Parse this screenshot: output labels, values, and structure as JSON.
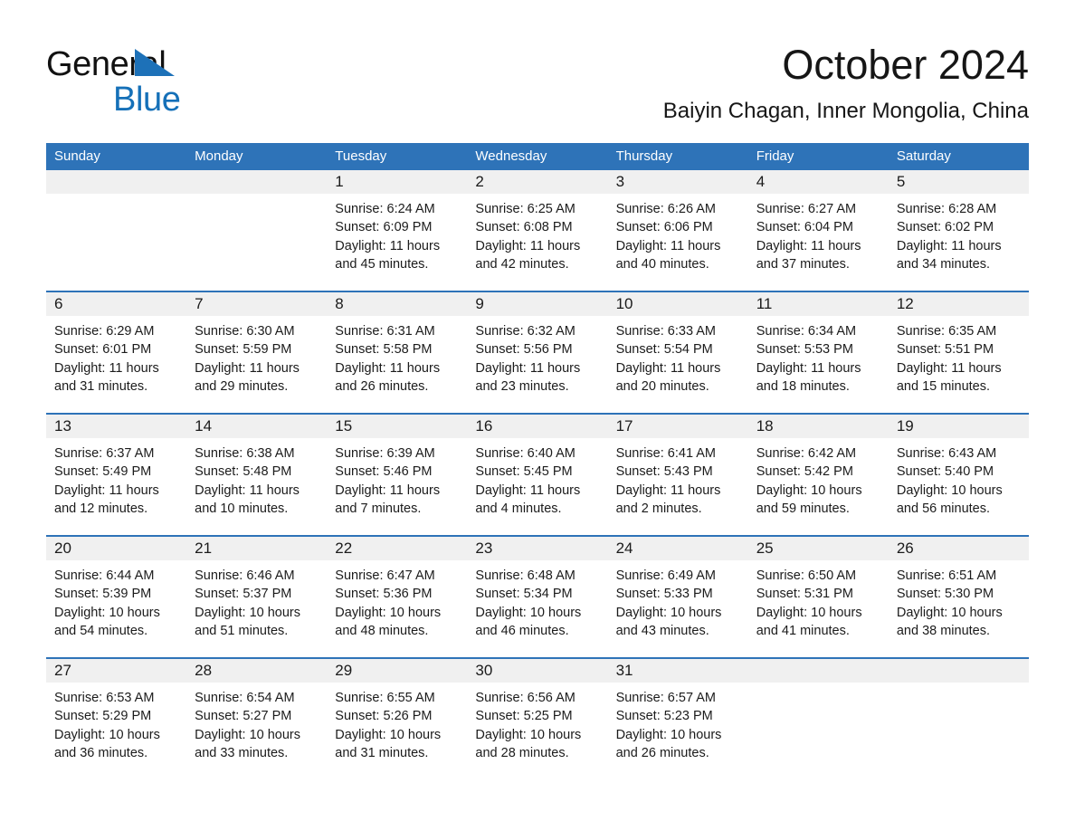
{
  "logo": {
    "line1": "General",
    "line2": "Blue",
    "triangle_color": "#1d71b8",
    "line2_color": "#1570b8"
  },
  "header": {
    "title": "October 2024",
    "subtitle": "Baiyin Chagan, Inner Mongolia, China"
  },
  "theme": {
    "header_blue": "#2e73b8",
    "row_divider_blue": "#2e73b8",
    "daynum_band": "#f0f0f0",
    "text": "#1b1b1b"
  },
  "weekdays": [
    "Sunday",
    "Monday",
    "Tuesday",
    "Wednesday",
    "Thursday",
    "Friday",
    "Saturday"
  ],
  "weeks": [
    [
      {
        "day": ""
      },
      {
        "day": ""
      },
      {
        "day": "1",
        "sunrise": "Sunrise: 6:24 AM",
        "sunset": "Sunset: 6:09 PM",
        "daylight": "Daylight: 11 hours and 45 minutes."
      },
      {
        "day": "2",
        "sunrise": "Sunrise: 6:25 AM",
        "sunset": "Sunset: 6:08 PM",
        "daylight": "Daylight: 11 hours and 42 minutes."
      },
      {
        "day": "3",
        "sunrise": "Sunrise: 6:26 AM",
        "sunset": "Sunset: 6:06 PM",
        "daylight": "Daylight: 11 hours and 40 minutes."
      },
      {
        "day": "4",
        "sunrise": "Sunrise: 6:27 AM",
        "sunset": "Sunset: 6:04 PM",
        "daylight": "Daylight: 11 hours and 37 minutes."
      },
      {
        "day": "5",
        "sunrise": "Sunrise: 6:28 AM",
        "sunset": "Sunset: 6:02 PM",
        "daylight": "Daylight: 11 hours and 34 minutes."
      }
    ],
    [
      {
        "day": "6",
        "sunrise": "Sunrise: 6:29 AM",
        "sunset": "Sunset: 6:01 PM",
        "daylight": "Daylight: 11 hours and 31 minutes."
      },
      {
        "day": "7",
        "sunrise": "Sunrise: 6:30 AM",
        "sunset": "Sunset: 5:59 PM",
        "daylight": "Daylight: 11 hours and 29 minutes."
      },
      {
        "day": "8",
        "sunrise": "Sunrise: 6:31 AM",
        "sunset": "Sunset: 5:58 PM",
        "daylight": "Daylight: 11 hours and 26 minutes."
      },
      {
        "day": "9",
        "sunrise": "Sunrise: 6:32 AM",
        "sunset": "Sunset: 5:56 PM",
        "daylight": "Daylight: 11 hours and 23 minutes."
      },
      {
        "day": "10",
        "sunrise": "Sunrise: 6:33 AM",
        "sunset": "Sunset: 5:54 PM",
        "daylight": "Daylight: 11 hours and 20 minutes."
      },
      {
        "day": "11",
        "sunrise": "Sunrise: 6:34 AM",
        "sunset": "Sunset: 5:53 PM",
        "daylight": "Daylight: 11 hours and 18 minutes."
      },
      {
        "day": "12",
        "sunrise": "Sunrise: 6:35 AM",
        "sunset": "Sunset: 5:51 PM",
        "daylight": "Daylight: 11 hours and 15 minutes."
      }
    ],
    [
      {
        "day": "13",
        "sunrise": "Sunrise: 6:37 AM",
        "sunset": "Sunset: 5:49 PM",
        "daylight": "Daylight: 11 hours and 12 minutes."
      },
      {
        "day": "14",
        "sunrise": "Sunrise: 6:38 AM",
        "sunset": "Sunset: 5:48 PM",
        "daylight": "Daylight: 11 hours and 10 minutes."
      },
      {
        "day": "15",
        "sunrise": "Sunrise: 6:39 AM",
        "sunset": "Sunset: 5:46 PM",
        "daylight": "Daylight: 11 hours and 7 minutes."
      },
      {
        "day": "16",
        "sunrise": "Sunrise: 6:40 AM",
        "sunset": "Sunset: 5:45 PM",
        "daylight": "Daylight: 11 hours and 4 minutes."
      },
      {
        "day": "17",
        "sunrise": "Sunrise: 6:41 AM",
        "sunset": "Sunset: 5:43 PM",
        "daylight": "Daylight: 11 hours and 2 minutes."
      },
      {
        "day": "18",
        "sunrise": "Sunrise: 6:42 AM",
        "sunset": "Sunset: 5:42 PM",
        "daylight": "Daylight: 10 hours and 59 minutes."
      },
      {
        "day": "19",
        "sunrise": "Sunrise: 6:43 AM",
        "sunset": "Sunset: 5:40 PM",
        "daylight": "Daylight: 10 hours and 56 minutes."
      }
    ],
    [
      {
        "day": "20",
        "sunrise": "Sunrise: 6:44 AM",
        "sunset": "Sunset: 5:39 PM",
        "daylight": "Daylight: 10 hours and 54 minutes."
      },
      {
        "day": "21",
        "sunrise": "Sunrise: 6:46 AM",
        "sunset": "Sunset: 5:37 PM",
        "daylight": "Daylight: 10 hours and 51 minutes."
      },
      {
        "day": "22",
        "sunrise": "Sunrise: 6:47 AM",
        "sunset": "Sunset: 5:36 PM",
        "daylight": "Daylight: 10 hours and 48 minutes."
      },
      {
        "day": "23",
        "sunrise": "Sunrise: 6:48 AM",
        "sunset": "Sunset: 5:34 PM",
        "daylight": "Daylight: 10 hours and 46 minutes."
      },
      {
        "day": "24",
        "sunrise": "Sunrise: 6:49 AM",
        "sunset": "Sunset: 5:33 PM",
        "daylight": "Daylight: 10 hours and 43 minutes."
      },
      {
        "day": "25",
        "sunrise": "Sunrise: 6:50 AM",
        "sunset": "Sunset: 5:31 PM",
        "daylight": "Daylight: 10 hours and 41 minutes."
      },
      {
        "day": "26",
        "sunrise": "Sunrise: 6:51 AM",
        "sunset": "Sunset: 5:30 PM",
        "daylight": "Daylight: 10 hours and 38 minutes."
      }
    ],
    [
      {
        "day": "27",
        "sunrise": "Sunrise: 6:53 AM",
        "sunset": "Sunset: 5:29 PM",
        "daylight": "Daylight: 10 hours and 36 minutes."
      },
      {
        "day": "28",
        "sunrise": "Sunrise: 6:54 AM",
        "sunset": "Sunset: 5:27 PM",
        "daylight": "Daylight: 10 hours and 33 minutes."
      },
      {
        "day": "29",
        "sunrise": "Sunrise: 6:55 AM",
        "sunset": "Sunset: 5:26 PM",
        "daylight": "Daylight: 10 hours and 31 minutes."
      },
      {
        "day": "30",
        "sunrise": "Sunrise: 6:56 AM",
        "sunset": "Sunset: 5:25 PM",
        "daylight": "Daylight: 10 hours and 28 minutes."
      },
      {
        "day": "31",
        "sunrise": "Sunrise: 6:57 AM",
        "sunset": "Sunset: 5:23 PM",
        "daylight": "Daylight: 10 hours and 26 minutes."
      },
      {
        "day": ""
      },
      {
        "day": ""
      }
    ]
  ]
}
